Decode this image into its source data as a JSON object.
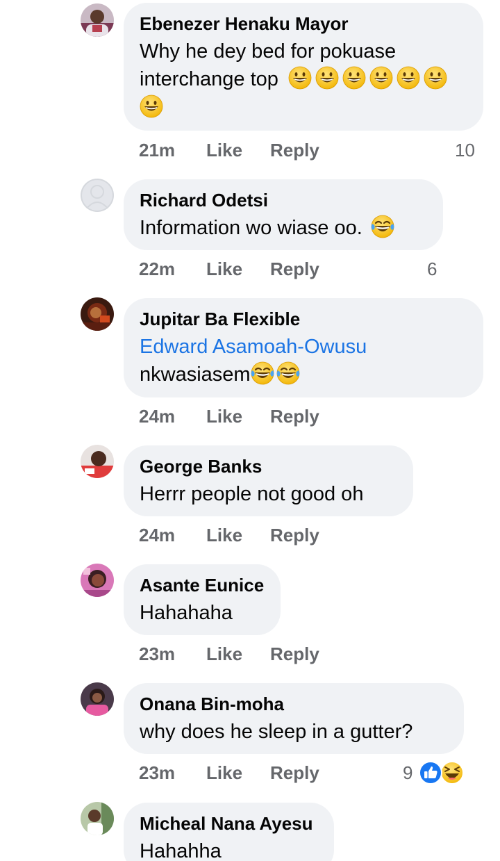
{
  "comments": [
    {
      "author": "Ebenezer Henaku Mayor",
      "text_line1": "Why he dey bed for pokuase",
      "text_line2": "interchange top",
      "emoji": "grinning-face-icon",
      "emoji_count": 7,
      "time": "21m",
      "like_label": "Like",
      "reply_label": "Reply",
      "reaction_count": "10"
    },
    {
      "author": "Richard Odetsi",
      "text": "Information wo wiase oo.",
      "emoji": "tears-of-joy-icon",
      "time": "22m",
      "like_label": "Like",
      "reply_label": "Reply",
      "reaction_count": "6"
    },
    {
      "author": "Jupitar Ba Flexible",
      "mention": "Edward Asamoah-Owusu",
      "text": "nkwasiasem",
      "emoji": "tears-of-joy-icon",
      "time": "24m",
      "like_label": "Like",
      "reply_label": "Reply"
    },
    {
      "author": "George Banks",
      "text": "Herrr people not good oh",
      "time": "24m",
      "like_label": "Like",
      "reply_label": "Reply"
    },
    {
      "author": "Asante Eunice",
      "text": "Hahahaha",
      "time": "23m",
      "like_label": "Like",
      "reply_label": "Reply"
    },
    {
      "author": "Onana Bin-moha",
      "text": "why does he sleep in a gutter?",
      "time": "23m",
      "like_label": "Like",
      "reply_label": "Reply",
      "reaction_count": "9",
      "reactions": [
        "like-reaction-icon",
        "haha-reaction-icon"
      ]
    },
    {
      "author": "Micheal Nana Ayesu",
      "text": "Hahahha"
    }
  ],
  "colors": {
    "bubble": "#f0f2f5",
    "text": "#050505",
    "secondary": "#65676b",
    "link": "#1b74e4",
    "like_blue": "#1877f2",
    "emoji_yellow": "#f7c131"
  }
}
